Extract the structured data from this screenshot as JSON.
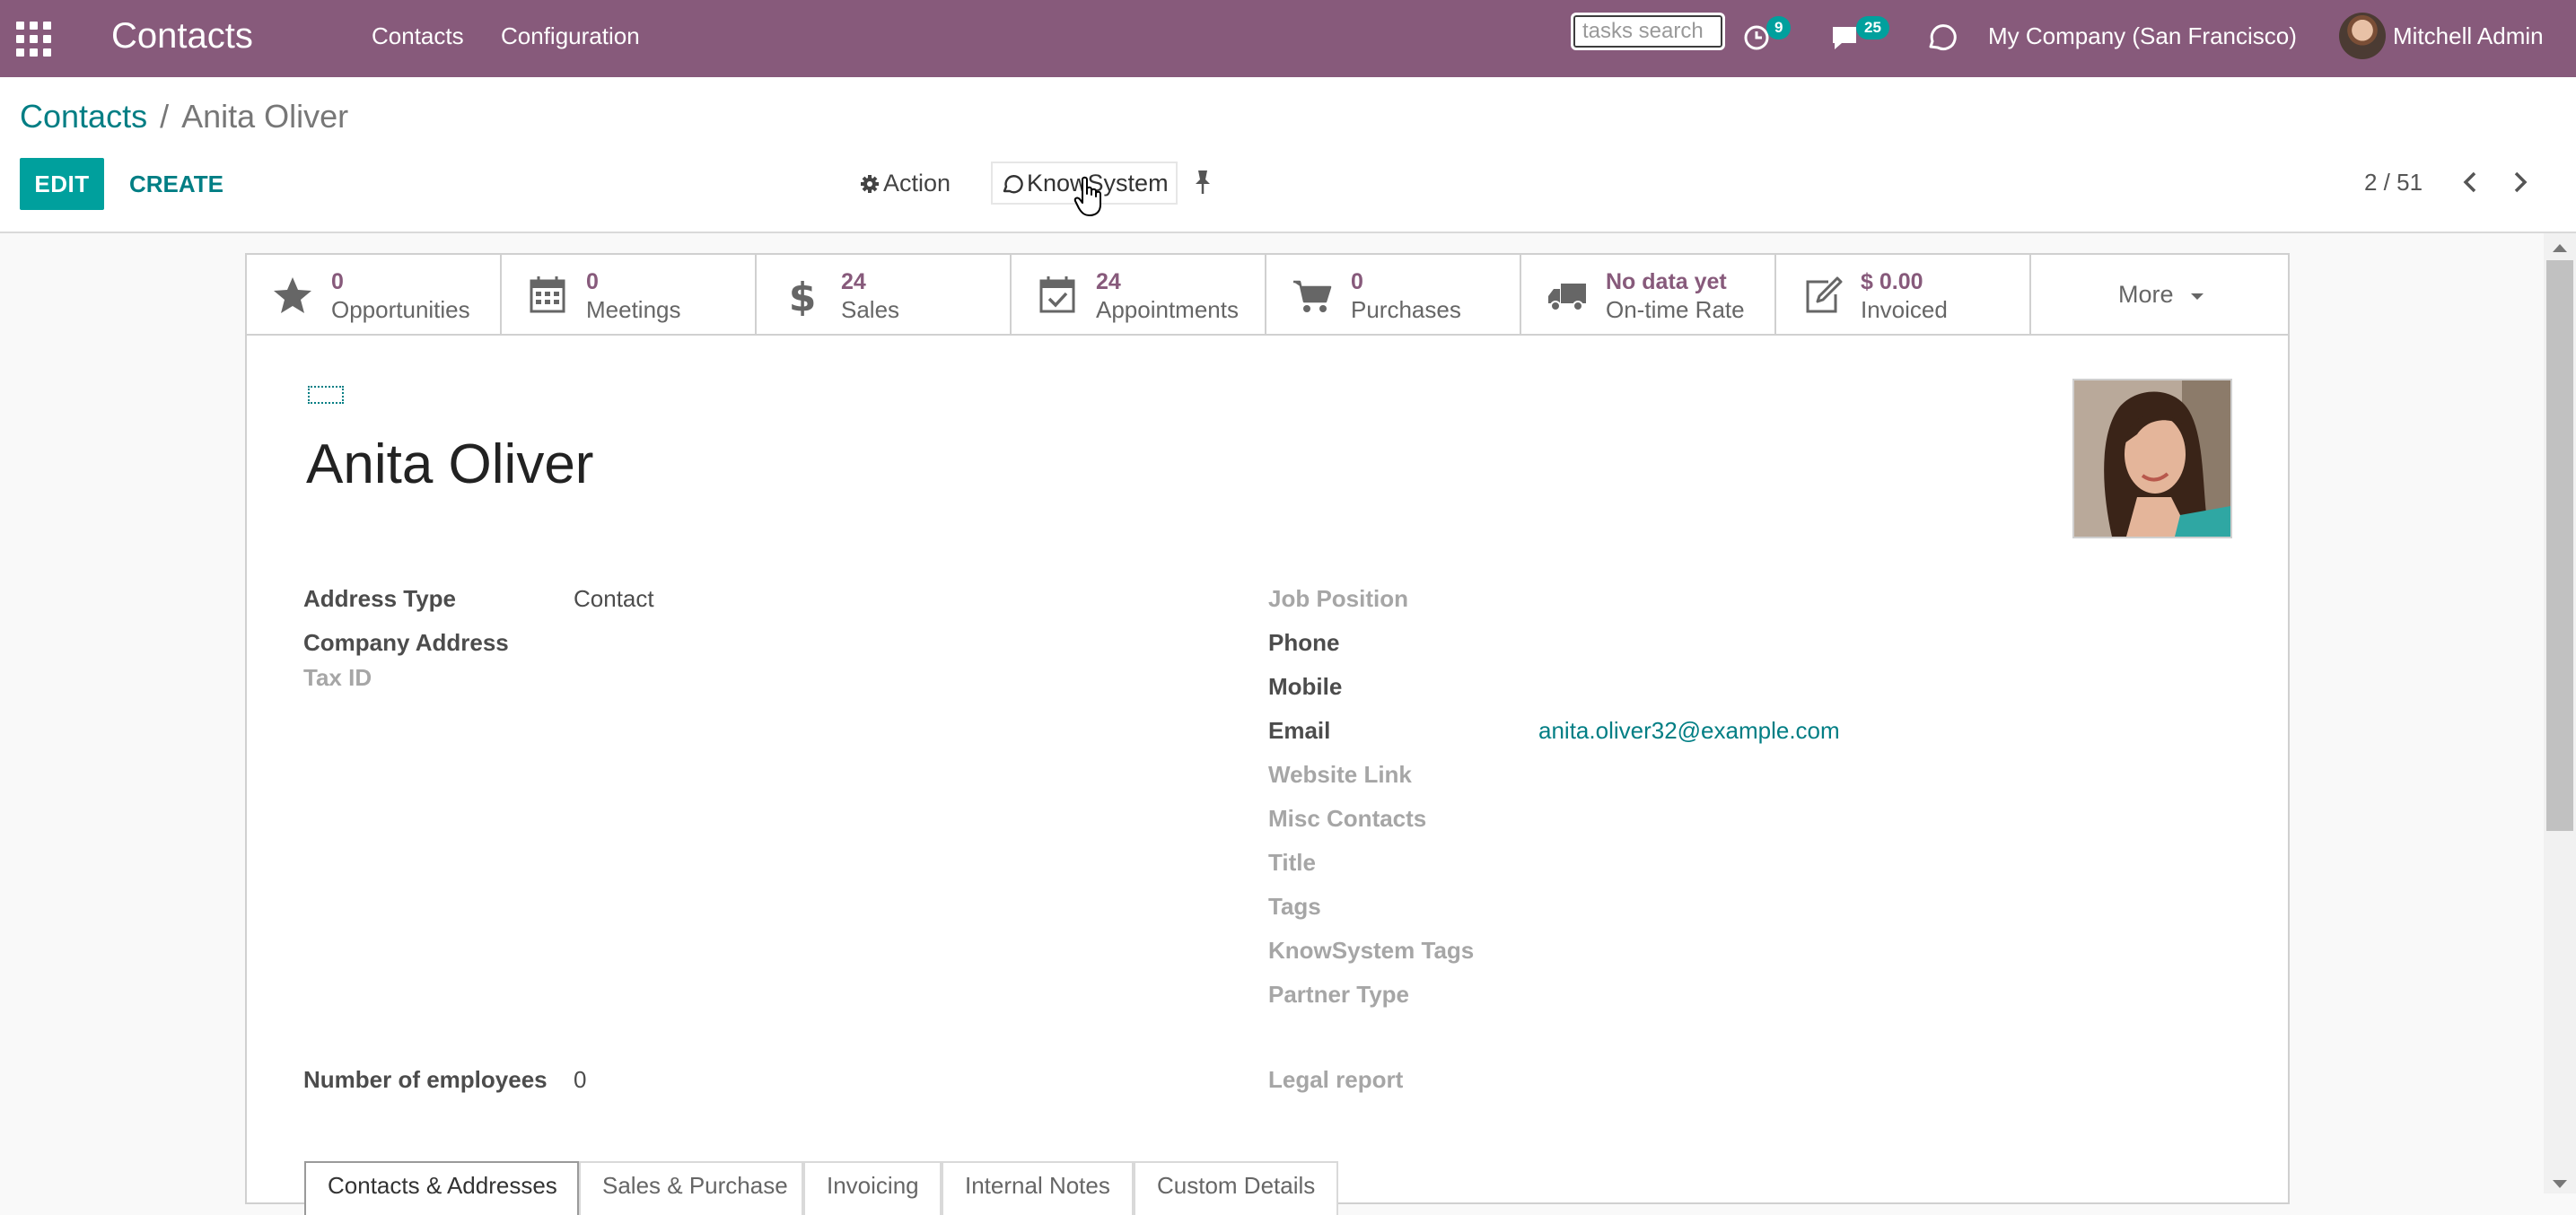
{
  "navbar": {
    "app_title": "Contacts",
    "menu": [
      "Contacts",
      "Configuration"
    ],
    "search_placeholder": "tasks search",
    "activity_count": "9",
    "messages_count": "25",
    "company": "My Company (San Francisco)",
    "user": "Mitchell Admin"
  },
  "breadcrumb": {
    "root": "Contacts",
    "separator": "/",
    "current": "Anita Oliver"
  },
  "toolbar": {
    "edit_label": "EDIT",
    "create_label": "CREATE",
    "action_label": "Action",
    "knowsystem_label": "KnowSystem",
    "pager": "2 / 51"
  },
  "stat_buttons": [
    {
      "value": "0",
      "label": "Opportunities",
      "icon": "star-icon"
    },
    {
      "value": "0",
      "label": "Meetings",
      "icon": "calendar-icon"
    },
    {
      "value": "24",
      "label": "Sales",
      "icon": "dollar-icon"
    },
    {
      "value": "24",
      "label": "Appointments",
      "icon": "calendar-check-icon"
    },
    {
      "value": "0",
      "label": "Purchases",
      "icon": "cart-icon"
    },
    {
      "value": "No data yet",
      "label": "On-time Rate",
      "icon": "truck-icon"
    },
    {
      "value": "$ 0.00",
      "label": "Invoiced",
      "icon": "edit-icon"
    }
  ],
  "more_label": "More",
  "form": {
    "name": "Anita Oliver",
    "left": {
      "address_type_label": "Address Type",
      "address_type_value": "Contact",
      "company_address_label": "Company Address",
      "tax_id_label": "Tax ID",
      "employees_label": "Number of employees",
      "employees_value": "0"
    },
    "right": {
      "job_position": "Job Position",
      "phone": "Phone",
      "mobile": "Mobile",
      "email_label": "Email",
      "email_value": "anita.oliver32@example.com",
      "website": "Website Link",
      "misc_contacts": "Misc Contacts",
      "title": "Title",
      "tags": "Tags",
      "knowsystem_tags": "KnowSystem Tags",
      "partner_type": "Partner Type",
      "legal_report": "Legal report"
    }
  },
  "tabs": [
    "Contacts & Addresses",
    "Sales & Purchase",
    "Invoicing",
    "Internal Notes",
    "Custom Details"
  ],
  "colors": {
    "brand": "#875a7b",
    "accent": "#00a09d",
    "link": "#017e84"
  }
}
